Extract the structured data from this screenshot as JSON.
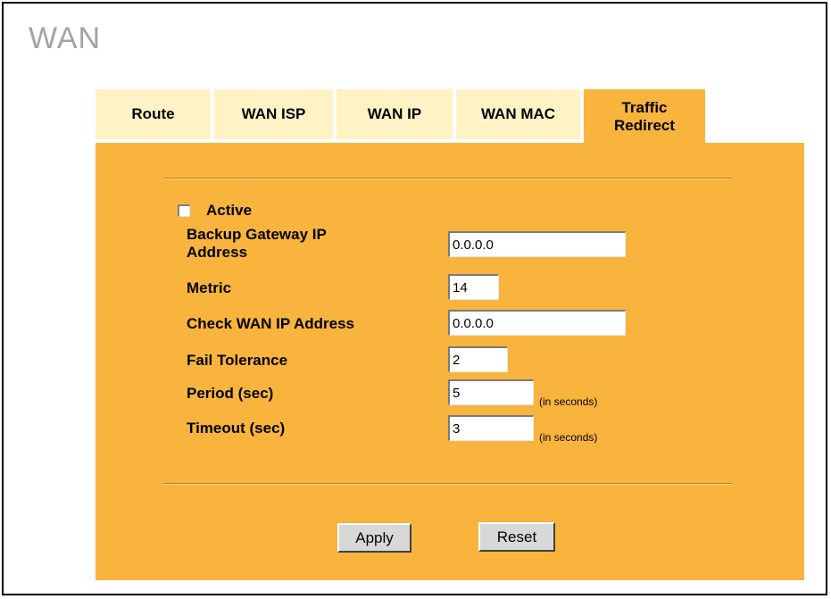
{
  "page": {
    "title": "WAN"
  },
  "tabs": [
    {
      "label": "Route"
    },
    {
      "label": "WAN ISP"
    },
    {
      "label": "WAN IP"
    },
    {
      "label": "WAN MAC"
    },
    {
      "label_line1": "Traffic",
      "label_line2": "Redirect",
      "active": true
    }
  ],
  "form": {
    "active": {
      "label": "Active",
      "checked": false
    },
    "backup_gateway": {
      "label_line1": "Backup Gateway IP",
      "label_line2": "Address",
      "value": "0.0.0.0"
    },
    "metric": {
      "label": "Metric",
      "value": "14"
    },
    "check_wan_ip": {
      "label": "Check WAN IP Address",
      "value": "0.0.0.0"
    },
    "fail_tolerance": {
      "label": "Fail Tolerance",
      "value": "2"
    },
    "period": {
      "label": "Period (sec)",
      "value": "5",
      "hint": "(in seconds)"
    },
    "timeout": {
      "label": "Timeout (sec)",
      "value": "3",
      "hint": "(in seconds)"
    }
  },
  "buttons": {
    "apply": "Apply",
    "reset": "Reset"
  },
  "colors": {
    "panel": "#f9b43d",
    "inactive_tab": "#fff2c4",
    "title": "#a3a3a3"
  }
}
